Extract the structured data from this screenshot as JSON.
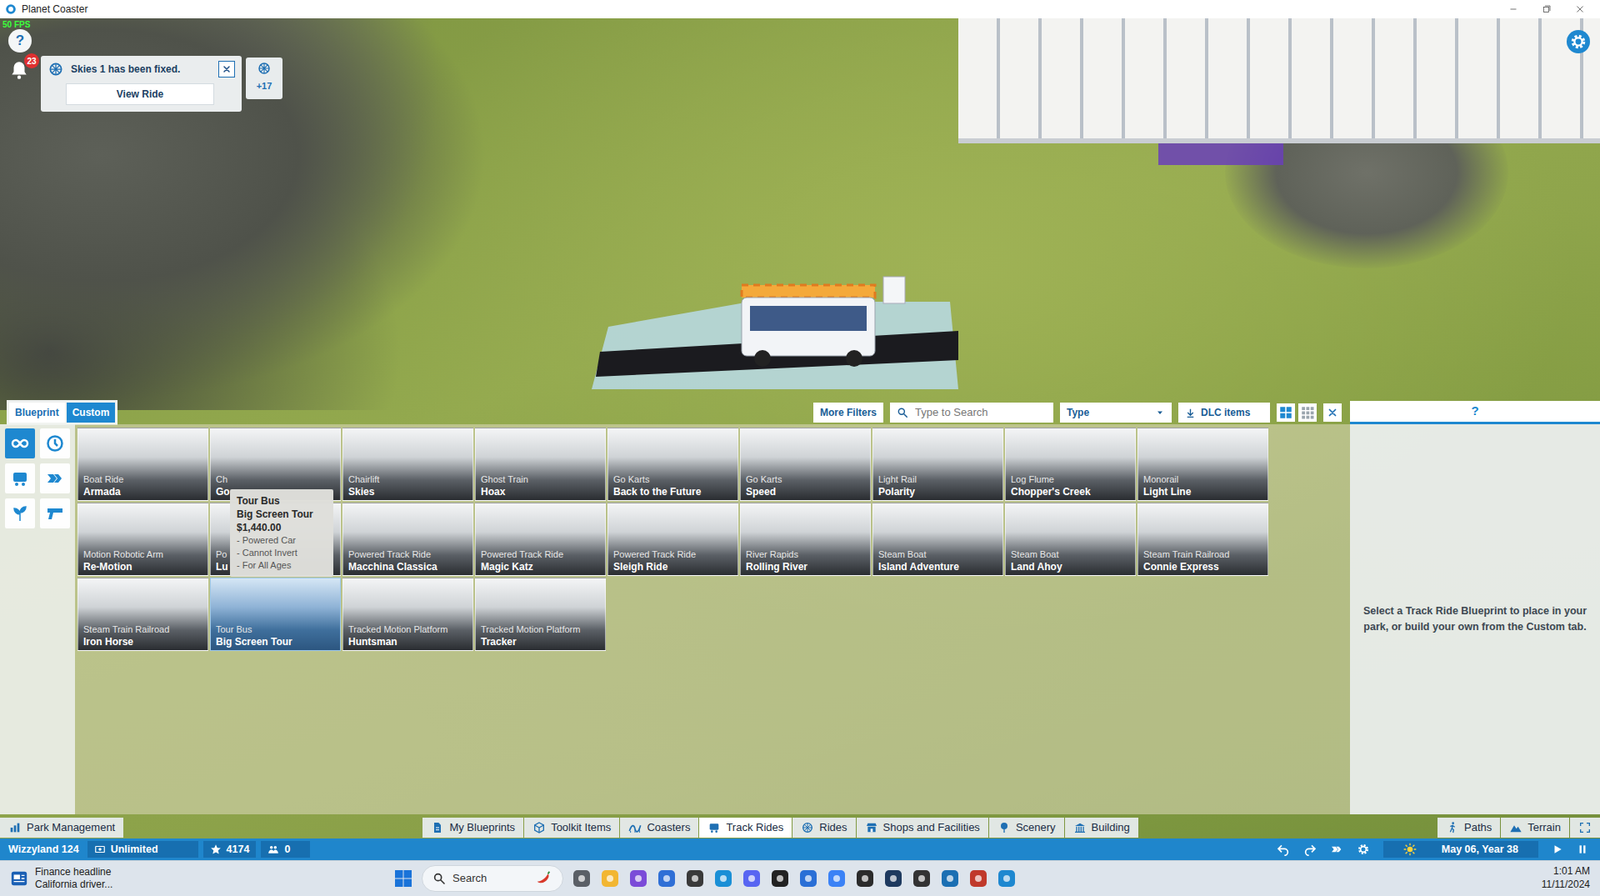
{
  "window": {
    "title": "Planet Coaster"
  },
  "hud": {
    "fps": "50 FPS",
    "help": "?",
    "alerts": "23"
  },
  "notification": {
    "message": "Skies 1 has been fixed.",
    "button": "View Ride",
    "more": "+17"
  },
  "panel": {
    "tabs": [
      {
        "label": "Blueprint",
        "selected": false
      },
      {
        "label": "Custom",
        "selected": true
      }
    ],
    "more_filters": "More Filters",
    "search": {
      "placeholder": "Type to Search"
    },
    "type_filter": "Type",
    "dlc": "DLC items",
    "views": [
      {
        "selected": true
      },
      {
        "selected": false
      }
    ],
    "categories": [
      {
        "selected": true
      },
      {
        "selected": false
      },
      {
        "selected": false
      },
      {
        "selected": false
      },
      {
        "selected": false
      },
      {
        "selected": false
      }
    ]
  },
  "items": [
    {
      "type": "Boat Ride",
      "name": "Armada",
      "selected": false
    },
    {
      "type": "Ch",
      "name": "Go",
      "selected": false
    },
    {
      "type": "Chairlift",
      "name": "Skies",
      "selected": false
    },
    {
      "type": "Ghost Train",
      "name": "Hoax",
      "selected": false
    },
    {
      "type": "Go Karts",
      "name": "Back to the Future",
      "selected": false
    },
    {
      "type": "Go Karts",
      "name": "Speed",
      "selected": false
    },
    {
      "type": "Light Rail",
      "name": "Polarity",
      "selected": false
    },
    {
      "type": "Log Flume",
      "name": "Chopper's Creek",
      "selected": false
    },
    {
      "type": "Monorail",
      "name": "Light Line",
      "selected": false
    },
    {
      "type": "Motion Robotic Arm",
      "name": "Re-Motion",
      "selected": false
    },
    {
      "type": "Po",
      "name": "Lu",
      "selected": false
    },
    {
      "type": "Powered Track Ride",
      "name": "Macchina Classica",
      "selected": false
    },
    {
      "type": "Powered Track Ride",
      "name": "Magic Katz",
      "selected": false
    },
    {
      "type": "Powered Track Ride",
      "name": "Sleigh Ride",
      "selected": false
    },
    {
      "type": "River Rapids",
      "name": "Rolling River",
      "selected": false
    },
    {
      "type": "Steam Boat",
      "name": "Island Adventure",
      "selected": false
    },
    {
      "type": "Steam Boat",
      "name": "Land Ahoy",
      "selected": false
    },
    {
      "type": "Steam Train Railroad",
      "name": "Connie Express",
      "selected": false
    },
    {
      "type": "Steam Train Railroad",
      "name": "Iron Horse",
      "selected": false
    },
    {
      "type": "Tour Bus",
      "name": "Big Screen Tour",
      "selected": true
    },
    {
      "type": "Tracked Motion Platform",
      "name": "Huntsman",
      "selected": false
    },
    {
      "type": "Tracked Motion Platform",
      "name": "Tracker",
      "selected": false
    }
  ],
  "tooltip": {
    "type": "Tour Bus",
    "name": "Big Screen Tour",
    "price": "$1,440.00",
    "features": [
      "- Powered Car",
      "- Cannot Invert",
      "- For All Ages"
    ]
  },
  "info": {
    "help": "?",
    "message": "Select a Track Ride Blueprint to place in your park, or build your own from the Custom tab."
  },
  "toolbar": {
    "left": [
      {
        "label": "Park Management",
        "selected": false
      }
    ],
    "center": [
      {
        "label": "My Blueprints",
        "selected": false
      },
      {
        "label": "Toolkit Items",
        "selected": false
      },
      {
        "label": "Coasters",
        "selected": false
      },
      {
        "label": "Track Rides",
        "selected": true
      },
      {
        "label": "Rides",
        "selected": false
      },
      {
        "label": "Shops and Facilities",
        "selected": false
      },
      {
        "label": "Scenery",
        "selected": false
      },
      {
        "label": "Building",
        "selected": false
      }
    ],
    "right": [
      {
        "label": "Paths",
        "selected": false
      },
      {
        "label": "Terrain",
        "selected": false
      }
    ]
  },
  "status_bar": {
    "park": "Wizzyland 124",
    "money": "Unlimited",
    "rating": "4174",
    "guests": "0",
    "date": "May 06, Year 38"
  },
  "taskbar": {
    "news_title": "Finance headline",
    "news_text": "California driver...",
    "search": "Search",
    "time": "1:01 AM",
    "date": "11/11/2024"
  }
}
